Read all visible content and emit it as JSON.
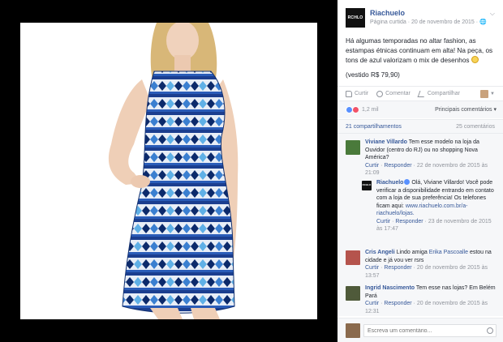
{
  "photo": {
    "alt": "",
    "watermark": "RCHLO"
  },
  "post": {
    "page_name": "Riachuelo",
    "logo_text": "RCHLO",
    "meta": "Página curtida · 20 de novembro de 2015 · 🌐",
    "text_main": "Há algumas temporadas no altar fashion, as estampas étnicas continuam em alta! Na peça, os tons de azul valorizam o mix de desenhos",
    "text_price": "(vestido R$ 79,90)"
  },
  "actions": {
    "like": "Curtir",
    "comment": "Comentar",
    "share": "Compartilhar"
  },
  "reactions": {
    "count": "1,2 mil",
    "sort_label": "Principais comentários"
  },
  "summary": {
    "shares": "21 compartilhamentos",
    "comments": "25 comentários"
  },
  "comments": [
    {
      "author": "Viviane Villardo",
      "text": "Tem esse modelo na loja da Ouvidor (centro do RJ) ou no shopping Nova América?",
      "like": "Curtir",
      "reply": "Responder",
      "date": "22 de novembro de 2015 às 21:09"
    },
    {
      "author": "Riachuelo",
      "text": "Olá, Viviane Villardo! Você pode verificar a disponibilidade entrando em contato com a loja de sua preferência! Os telefones ficam aqui:",
      "link": "www.riachuelo.com.br/a-riachuelo/lojas.",
      "like": "Curtir",
      "reply": "Responder",
      "date": "23 de novembro de 2015 às 17:47"
    },
    {
      "author": "Cris Angeli",
      "text_pre": "Lindo amiga",
      "mention": "Erika Pascoalle",
      "text_post": "estou na cidade e já vou ver rsrs",
      "like": "Curtir",
      "reply": "Responder",
      "date": "20 de novembro de 2015 às 13:57"
    },
    {
      "author": "Ingrid Nascimento",
      "text": "Tem esse nas lojas? Em Belém Pará",
      "like": "Curtir",
      "reply": "Responder",
      "date": "20 de novembro de 2015 às 12:31"
    }
  ],
  "composer": {
    "placeholder": "Escreva um comentário..."
  },
  "colors": {
    "link": "#365899",
    "muted": "#90949c",
    "panel_bg": "#f6f7f9",
    "viewer_bg": "#000000"
  }
}
